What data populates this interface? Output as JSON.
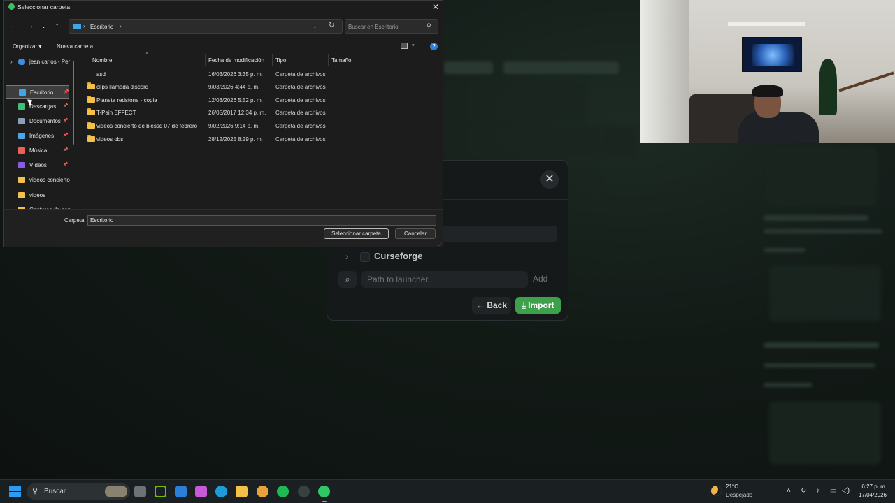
{
  "dialog": {
    "title": "Seleccionar carpeta",
    "address": {
      "segments": [
        "Escritorio"
      ]
    },
    "search_placeholder": "Buscar en Escritorio",
    "toolbar": {
      "organize": "Organizar",
      "new_folder": "Nueva carpeta"
    },
    "nav": {
      "top": "jean carlos - Per",
      "items": [
        {
          "label": "Escritorio",
          "icon": "desktop-icon",
          "color": "#3da8e8",
          "pinned": true
        },
        {
          "label": "Descargas",
          "icon": "downloads-icon",
          "color": "#3fbf6f",
          "pinned": true
        },
        {
          "label": "Documentos",
          "icon": "documents-icon",
          "color": "#8aa0b8",
          "pinned": true
        },
        {
          "label": "Imágenes",
          "icon": "pictures-icon",
          "color": "#4aa6e8",
          "pinned": true
        },
        {
          "label": "Música",
          "icon": "music-icon",
          "color": "#e8625a",
          "pinned": true
        },
        {
          "label": "Vídeos",
          "icon": "videos-icon",
          "color": "#8a5ae8",
          "pinned": true
        },
        {
          "label": "videos concierto",
          "icon": "folder-icon",
          "color": "#f3c14a",
          "pinned": false
        },
        {
          "label": "videos",
          "icon": "folder-icon",
          "color": "#f3c14a",
          "pinned": false
        },
        {
          "label": "Capturas de pan",
          "icon": "folder-icon",
          "color": "#f3c14a",
          "pinned": false
        }
      ]
    },
    "columns": {
      "name": "Nombre",
      "date": "Fecha de modificación",
      "type": "Tipo",
      "size": "Tamaño"
    },
    "files": [
      {
        "name": "asd",
        "date": "16/03/2026 3:35 p. m.",
        "type": "Carpeta de archivos",
        "has_icon": false
      },
      {
        "name": "clips llamada discord",
        "date": "9/03/2026 4:44 p. m.",
        "type": "Carpeta de archivos",
        "has_icon": true
      },
      {
        "name": "Planeta redstone - copia",
        "date": "12/03/2026 5:52 p. m.",
        "type": "Carpeta de archivos",
        "has_icon": true
      },
      {
        "name": "T-Pain EFFECT",
        "date": "26/05/2017 12:34 p. m.",
        "type": "Carpeta de archivos",
        "has_icon": true
      },
      {
        "name": "videos concierto de blessd 07 de febrero",
        "date": "9/02/2026 9:14 p. m.",
        "type": "Carpeta de archivos",
        "has_icon": true
      },
      {
        "name": "videos obs",
        "date": "28/12/2025 8:29 p. m.",
        "type": "Carpeta de archivos",
        "has_icon": true
      }
    ],
    "folder_label": "Carpeta:",
    "folder_value": "Escritorio",
    "select_button": "Seleccionar carpeta",
    "cancel_button": "Cancelar"
  },
  "modal": {
    "launcher_name": "Curseforge",
    "path_placeholder": "Path to launcher...",
    "add_label": "Add",
    "back_label": "Back",
    "import_label": "Import",
    "accent": "#3da14c"
  },
  "taskbar": {
    "search_label": "Buscar",
    "temperature": "21°C",
    "weather": "Despejado",
    "time": "6:27 p. m.",
    "date": "17/04/2026",
    "apps": [
      "task-view-icon",
      "nvidia-icon",
      "store-icon",
      "copilot-icon",
      "edge-icon",
      "explorer-icon",
      "chrome-icon",
      "spotify-icon",
      "steam-icon",
      "modrinth-icon"
    ]
  }
}
